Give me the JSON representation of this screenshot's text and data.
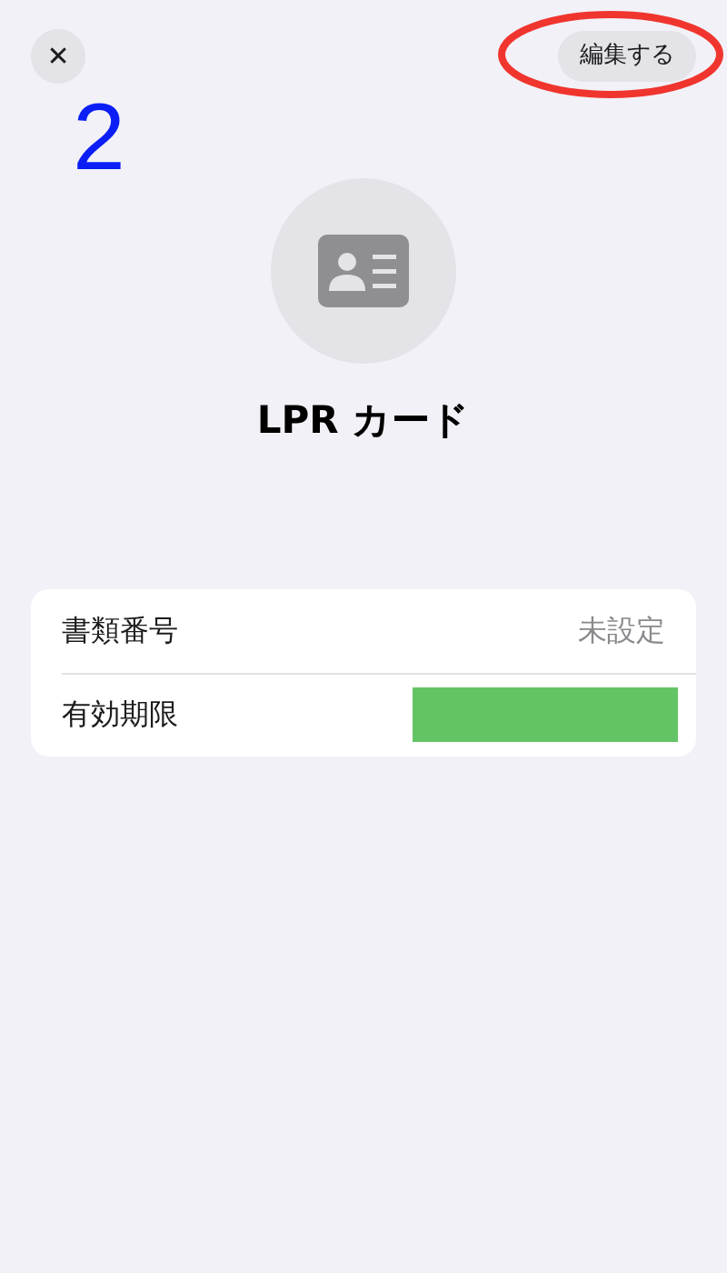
{
  "header": {
    "close_label": "✕",
    "edit_button": "編集する"
  },
  "annotations": {
    "step_number": "2",
    "edit_button_circled": true
  },
  "title": "LPR カード",
  "fields": [
    {
      "kind": "text",
      "label": "書類番号",
      "value": "未設定"
    },
    {
      "kind": "redacted",
      "label": "有効期限"
    }
  ]
}
